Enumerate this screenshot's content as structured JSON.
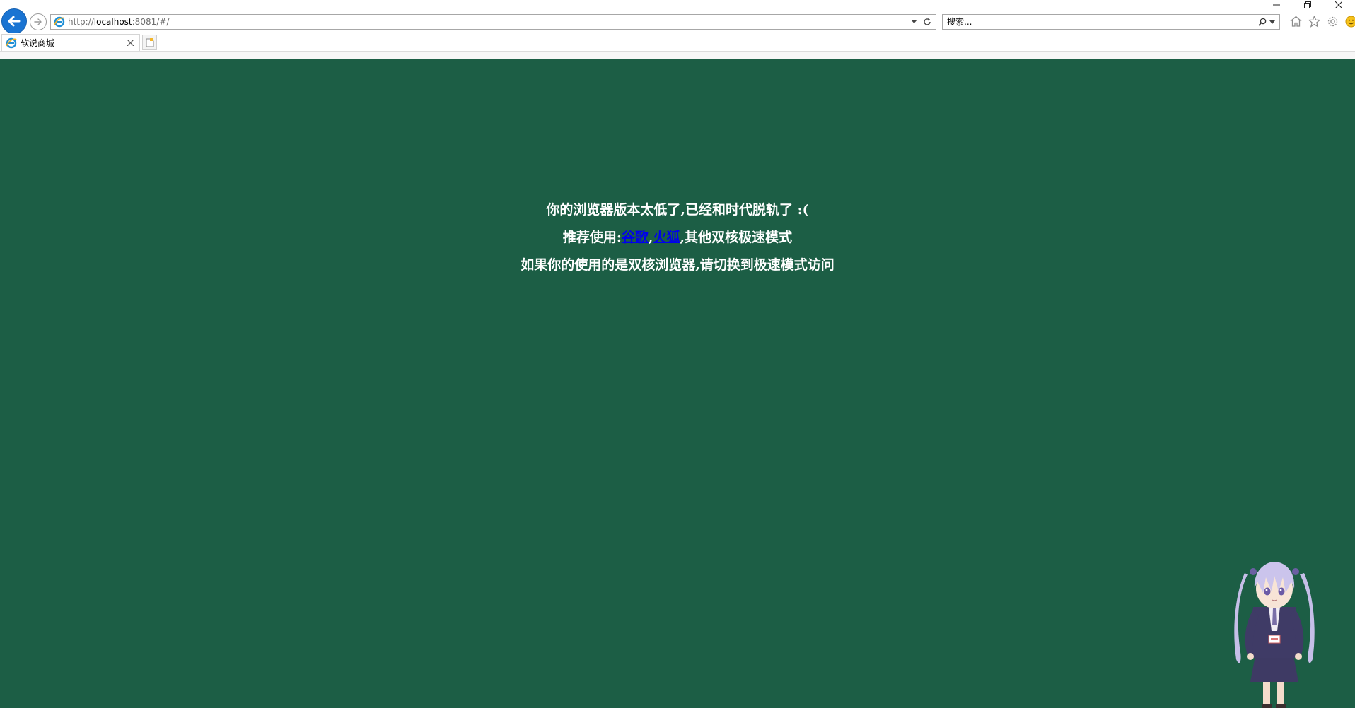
{
  "window": {
    "controls": [
      {
        "name": "minimize-icon"
      },
      {
        "name": "restore-icon"
      },
      {
        "name": "close-icon"
      }
    ]
  },
  "toolbar": {
    "back_icon": "back-arrow-icon",
    "forward_icon": "forward-arrow-icon",
    "address": {
      "url_scheme": "http://",
      "url_host": "localhost",
      "url_rest": ":8081/#/"
    },
    "search": {
      "placeholder": "搜索..."
    },
    "right_icons": [
      "home-icon",
      "favorites-star-icon",
      "settings-gear-icon",
      "feedback-smiley-icon"
    ]
  },
  "tabs": [
    {
      "title": "软说商城",
      "active": true
    }
  ],
  "page": {
    "background": "#1c5e45",
    "line1": "你的浏览器版本太低了,已经和时代脱轨了 :(",
    "line2_prefix": "推荐使用:",
    "link_chrome": "谷歌",
    "separator": ",",
    "link_firefox": "火狐",
    "line2_suffix": ",其他双核极速模式",
    "line3": "如果你的使用的是双核浏览器,请切换到极速模式访问",
    "link_color": "#0000ee"
  }
}
